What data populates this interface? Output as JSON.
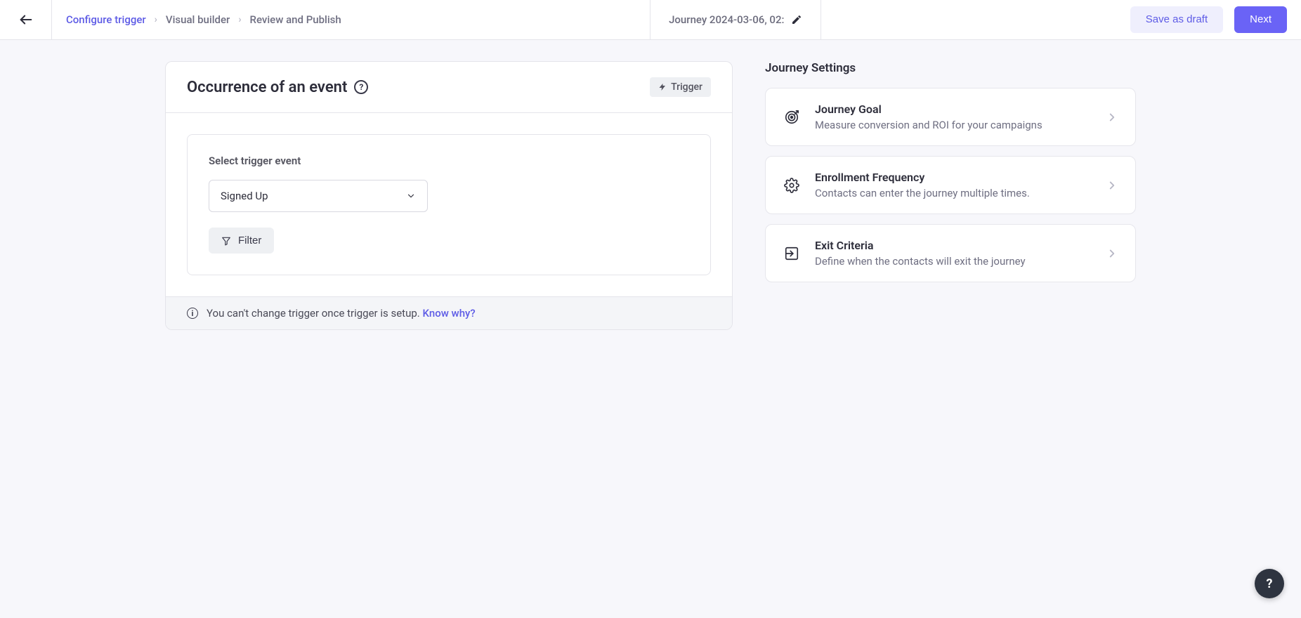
{
  "header": {
    "breadcrumb": [
      {
        "label": "Configure trigger",
        "active": true
      },
      {
        "label": "Visual builder",
        "active": false
      },
      {
        "label": "Review and Publish",
        "active": false
      }
    ],
    "title": "Journey 2024-03-06, 02:",
    "save_draft_label": "Save as draft",
    "next_label": "Next"
  },
  "card": {
    "title": "Occurrence of an event",
    "badge": "Trigger",
    "field_label": "Select trigger event",
    "selected_event": "Signed Up",
    "filter_label": "Filter",
    "footer_text": "You can't change trigger once trigger is setup.",
    "footer_link": "Know why?"
  },
  "settings": {
    "heading": "Journey Settings",
    "items": [
      {
        "icon": "target",
        "title": "Journey Goal",
        "desc": "Measure conversion and ROI for your campaigns"
      },
      {
        "icon": "gear",
        "title": "Enrollment Frequency",
        "desc": "Contacts can enter the journey multiple times."
      },
      {
        "icon": "exit",
        "title": "Exit Criteria",
        "desc": "Define when the contacts will exit the journey"
      }
    ]
  }
}
